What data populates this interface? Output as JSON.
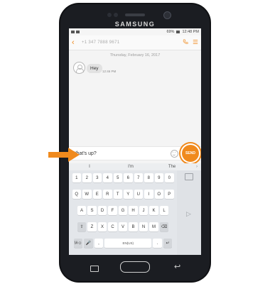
{
  "phone": {
    "brand": "SAMSUNG"
  },
  "status_bar": {
    "signal_battery": "69%",
    "time": "12:48 PM"
  },
  "app_bar": {
    "back_icon": "back-arrow-icon",
    "contact_name": "+1 347 7888 9671",
    "call_icon": "phone-icon",
    "menu_icon": "menu-icon",
    "accent_color": "#f08a1d"
  },
  "thread": {
    "date": "Thursday, February 16, 2017",
    "messages": [
      {
        "text": "Hey",
        "time": "12:46 PM"
      }
    ]
  },
  "compose": {
    "text": "What's up?",
    "send_label": "SEND",
    "emoji_icon": "emoji-icon"
  },
  "suggestions": [
    "I",
    "I'm",
    "The"
  ],
  "keyboard": {
    "row_numbers": [
      "1",
      "2",
      "3",
      "4",
      "5",
      "6",
      "7",
      "8",
      "9",
      "0"
    ],
    "row_top": [
      "Q",
      "W",
      "E",
      "R",
      "T",
      "Y",
      "U",
      "I",
      "O",
      "P"
    ],
    "row_mid": [
      "A",
      "S",
      "D",
      "F",
      "G",
      "H",
      "J",
      "K",
      "L"
    ],
    "row_bottom": [
      "Z",
      "X",
      "C",
      "V",
      "B",
      "N",
      "M"
    ],
    "symbol_key": "!#☺",
    "comma_key": ",",
    "space_key": "EN(US)",
    "period_key": ".",
    "enter_key": "↵",
    "shift_key": "⇧",
    "backspace_key": "⌫"
  }
}
